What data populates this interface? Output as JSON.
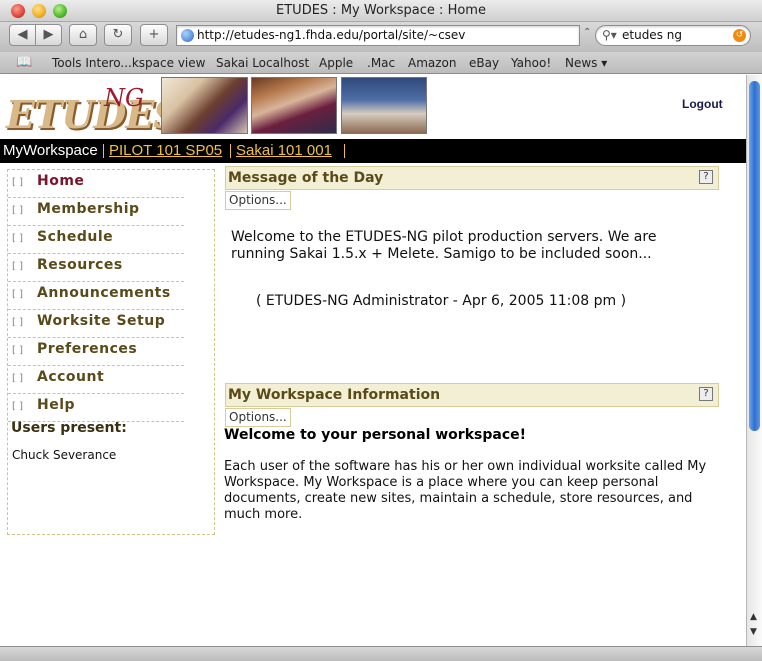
{
  "window": {
    "title": "ETUDES : My Workspace : Home"
  },
  "toolbar": {
    "url": "http://etudes-ng1.fhda.edu/portal/site/~csev",
    "search_value": "etudes ng"
  },
  "bookmarks": [
    "Tools Intero...kspace view",
    "Sakai Localhost",
    "Apple",
    ".Mac",
    "Amazon",
    "eBay",
    "Yahoo!",
    "News ▾"
  ],
  "header": {
    "logo_main": "ETUDES",
    "logo_suffix": "NG",
    "logout_label": "Logout"
  },
  "sites": {
    "current": "MyWorkspace",
    "links": [
      "PILOT 101 SP05",
      "Sakai 101 001"
    ]
  },
  "tools": [
    {
      "label": "Home",
      "active": true
    },
    {
      "label": "Membership",
      "active": false
    },
    {
      "label": "Schedule",
      "active": false
    },
    {
      "label": "Resources",
      "active": false
    },
    {
      "label": "Announcements",
      "active": false
    },
    {
      "label": "Worksite Setup",
      "active": false
    },
    {
      "label": "Preferences",
      "active": false
    },
    {
      "label": "Account",
      "active": false
    },
    {
      "label": "Help",
      "active": false
    }
  ],
  "presence": {
    "title": "Users present:",
    "users": [
      "Chuck Severance"
    ]
  },
  "motd": {
    "title": "Message of the Day",
    "options_label": "Options...",
    "text": "Welcome to the ETUDES-NG pilot production servers. We are running Sakai 1.5.x + Melete. Samigo to be included soon...",
    "signature": "( ETUDES-NG Administrator - Apr 6, 2005 11:08 pm )"
  },
  "workspace_info": {
    "title": "My Workspace Information",
    "options_label": "Options...",
    "welcome": "Welcome to your personal workspace!",
    "body": "Each user of the software has his or her own individual worksite called My Workspace. My Workspace is a place where you can keep personal documents, create new sites, maintain a schedule, store resources, and much more."
  }
}
